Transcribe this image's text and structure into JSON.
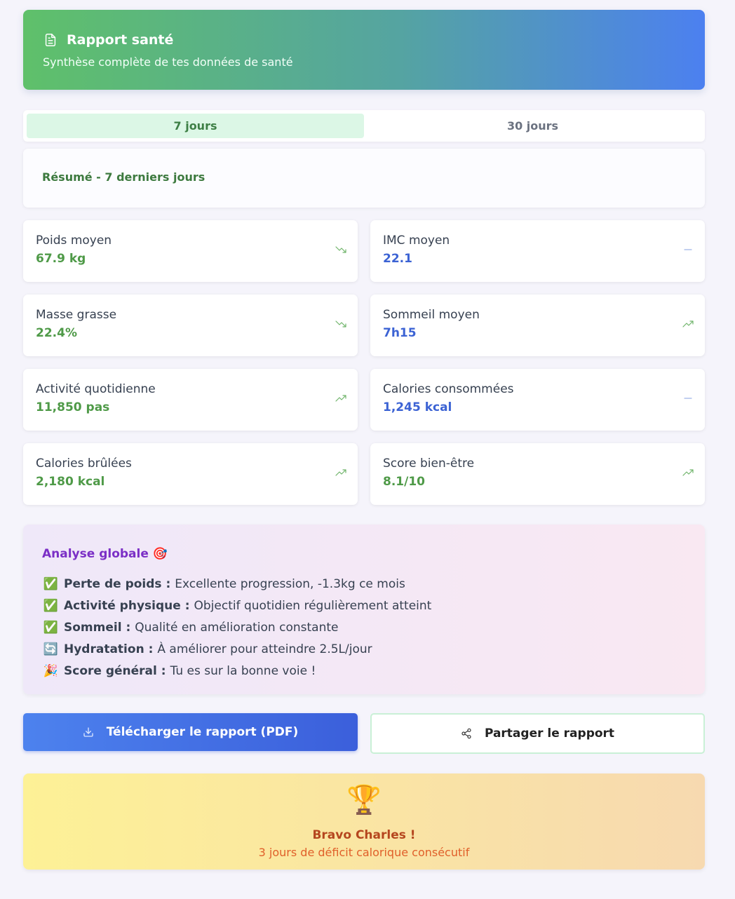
{
  "header": {
    "title": "Rapport santé",
    "subtitle": "Synthèse complète de tes données de santé",
    "icon": "document-icon"
  },
  "tabs": [
    {
      "label": "7 jours",
      "active": true
    },
    {
      "label": "30 jours",
      "active": false
    }
  ],
  "summary": {
    "title": "Résumé - 7 derniers jours"
  },
  "metrics": [
    {
      "label": "Poids moyen",
      "value": "67.9 kg",
      "color": "green",
      "trend": "down"
    },
    {
      "label": "IMC moyen",
      "value": "22.1",
      "color": "blue",
      "trend": "flat"
    },
    {
      "label": "Masse grasse",
      "value": "22.4%",
      "color": "green",
      "trend": "down"
    },
    {
      "label": "Sommeil moyen",
      "value": "7h15",
      "color": "blue",
      "trend": "up"
    },
    {
      "label": "Activité quotidienne",
      "value": "11,850 pas",
      "color": "green",
      "trend": "up"
    },
    {
      "label": "Calories consommées",
      "value": "1,245 kcal",
      "color": "blue",
      "trend": "flat"
    },
    {
      "label": "Calories brûlées",
      "value": "2,180 kcal",
      "color": "green",
      "trend": "up"
    },
    {
      "label": "Score bien-être",
      "value": "8.1/10",
      "color": "green",
      "trend": "up"
    }
  ],
  "analysis": {
    "title": "Analyse globale",
    "title_emoji": "🎯",
    "items": [
      {
        "icon": "✅",
        "label": "Perte de poids :",
        "text": "Excellente progression, -1.3kg ce mois"
      },
      {
        "icon": "✅",
        "label": "Activité physique :",
        "text": "Objectif quotidien régulièrement atteint"
      },
      {
        "icon": "✅",
        "label": "Sommeil :",
        "text": "Qualité en amélioration constante"
      },
      {
        "icon": "🔄",
        "label": "Hydratation :",
        "text": "À améliorer pour atteindre 2.5L/jour"
      },
      {
        "icon": "🎉",
        "label": "Score général :",
        "text": "Tu es sur la bonne voie !"
      }
    ]
  },
  "actions": {
    "download_label": "Télécharger le rapport (PDF)",
    "share_label": "Partager le rapport"
  },
  "congrats": {
    "emoji": "🏆",
    "title": "Bravo Charles !",
    "subtitle": "3 jours de déficit calorique consécutif"
  },
  "colors": {
    "green": "#4f9a48",
    "blue": "#3c63d4",
    "purple": "#7b2fc6"
  }
}
